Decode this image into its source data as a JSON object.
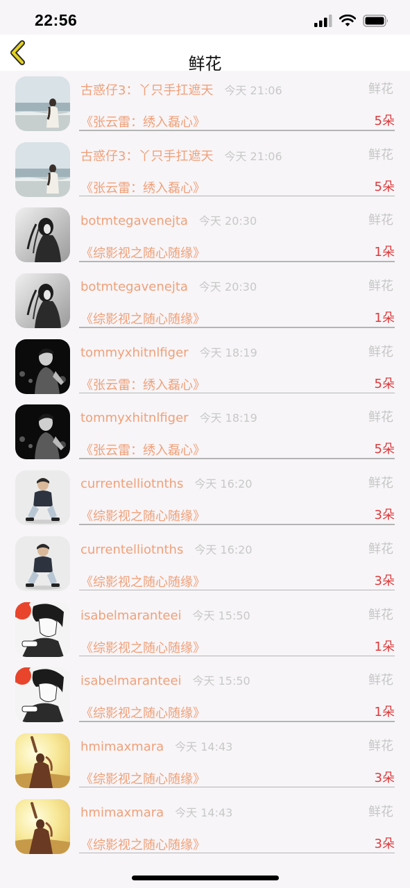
{
  "status": {
    "time": "22:56"
  },
  "nav": {
    "title": "鲜花"
  },
  "colors": {
    "name": "#f0a078",
    "count": "#dd3a3a",
    "time": "#c8c8c8",
    "back_icon": "#e6d21e"
  },
  "rows": [
    {
      "name": "古惑仔3：丫只手扛遮天",
      "time": "今天 21:06",
      "type": "鲜花",
      "book": "《张云雷：绣入磊心》",
      "count": "5朵",
      "avatar": "beach-girl"
    },
    {
      "name": "古惑仔3：丫只手扛遮天",
      "time": "今天 21:06",
      "type": "鲜花",
      "book": "《张云雷：绣入磊心》",
      "count": "5朵",
      "avatar": "beach-girl"
    },
    {
      "name": "botmtegavenejta",
      "time": "今天 20:30",
      "type": "鲜花",
      "book": "《综影视之随心随缘》",
      "count": "1朵",
      "avatar": "bw-girl"
    },
    {
      "name": "botmtegavenejta",
      "time": "今天 20:30",
      "type": "鲜花",
      "book": "《综影视之随心随缘》",
      "count": "1朵",
      "avatar": "bw-girl"
    },
    {
      "name": "tommyxhitnlfiger",
      "time": "今天 18:19",
      "type": "鲜花",
      "book": "《张云雷：绣入磊心》",
      "count": "5朵",
      "avatar": "night-man"
    },
    {
      "name": "tommyxhitnlfiger",
      "time": "今天 18:19",
      "type": "鲜花",
      "book": "《张云雷：绣入磊心》",
      "count": "5朵",
      "avatar": "night-man"
    },
    {
      "name": "currentelliotnths",
      "time": "今天 16:20",
      "type": "鲜花",
      "book": "《综影视之随心随缘》",
      "count": "3朵",
      "avatar": "crouch-man"
    },
    {
      "name": "currentelliotnths",
      "time": "今天 16:20",
      "type": "鲜花",
      "book": "《综影视之随心随缘》",
      "count": "3朵",
      "avatar": "crouch-man"
    },
    {
      "name": "isabelmaranteei",
      "time": "今天 15:50",
      "type": "鲜花",
      "book": "《综影视之随心随缘》",
      "count": "1朵",
      "avatar": "manga-boy"
    },
    {
      "name": "isabelmaranteei",
      "time": "今天 15:50",
      "type": "鲜花",
      "book": "《综影视之随心随缘》",
      "count": "1朵",
      "avatar": "manga-boy"
    },
    {
      "name": "hmimaxmara",
      "time": "今天 14:43",
      "type": "鲜花",
      "book": "《综影视之随心随缘》",
      "count": "3朵",
      "avatar": "sunset-girl"
    },
    {
      "name": "hmimaxmara",
      "time": "今天 14:43",
      "type": "鲜花",
      "book": "《综影视之随心随缘》",
      "count": "3朵",
      "avatar": "sunset-girl"
    }
  ]
}
